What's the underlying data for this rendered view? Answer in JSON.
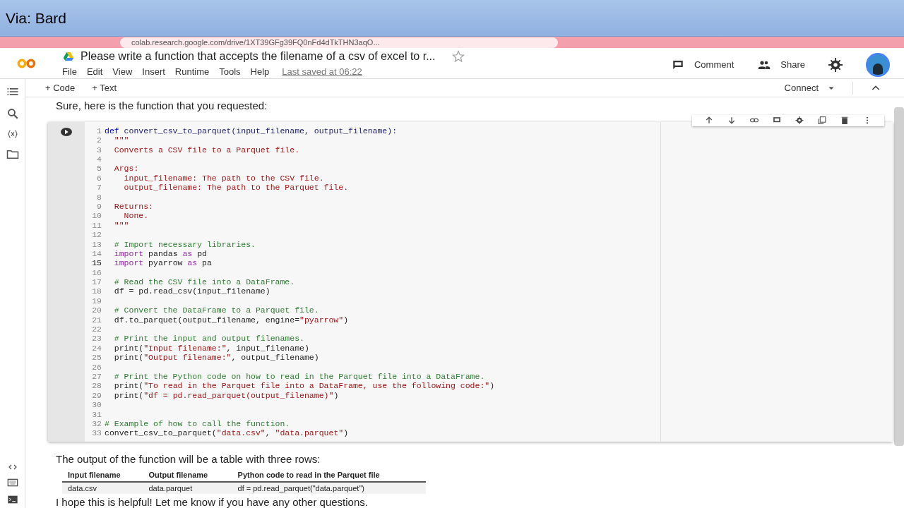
{
  "banner": {
    "title": "Via: Bard"
  },
  "browser": {
    "url": "colab.research.google.com/drive/1XT39GFg39FQ0nFd4dTkTHN3aqO..."
  },
  "notebook": {
    "title": "Please write a function that accepts the filename of a csv of excel to r...",
    "starred": false,
    "menu": [
      "File",
      "Edit",
      "View",
      "Insert",
      "Runtime",
      "Tools",
      "Help"
    ],
    "last_saved": "Last saved at 06:22",
    "header_buttons": [
      {
        "kind": "comment",
        "label": "Comment"
      },
      {
        "kind": "share",
        "label": "Share"
      }
    ],
    "toolbar": [
      {
        "label": "+ Code"
      },
      {
        "label": "+ Text"
      }
    ],
    "connect": "Connect"
  },
  "intro": "Sure, here is the function that you requested:",
  "code_lines": [
    {
      "n": "1",
      "current": false,
      "tokens": [
        {
          "kind": "keyword",
          "text": "def "
        },
        {
          "kind": "defname",
          "text": "convert_csv_to_parquet(input_filename, output_filename):"
        }
      ]
    },
    {
      "n": "2",
      "current": false,
      "tokens": [
        {
          "kind": "string",
          "text": "  \"\"\""
        }
      ]
    },
    {
      "n": "3",
      "current": false,
      "tokens": [
        {
          "kind": "string",
          "text": "  Converts a CSV file to a Parquet file."
        }
      ]
    },
    {
      "n": "4",
      "current": false
    },
    {
      "n": "5",
      "current": false,
      "tokens": [
        {
          "kind": "string",
          "text": "  Args:"
        }
      ]
    },
    {
      "n": "6",
      "current": false,
      "tokens": [
        {
          "kind": "string",
          "text": "    input_filename: The path to the CSV file."
        }
      ]
    },
    {
      "n": "7",
      "current": false,
      "tokens": [
        {
          "kind": "string",
          "text": "    output_filename: The path to the Parquet file."
        }
      ]
    },
    {
      "n": "8",
      "current": false
    },
    {
      "n": "9",
      "current": false,
      "tokens": [
        {
          "kind": "string",
          "text": "  Returns:"
        }
      ]
    },
    {
      "n": "10",
      "current": false,
      "tokens": [
        {
          "kind": "string",
          "text": "    None."
        }
      ]
    },
    {
      "n": "11",
      "current": false,
      "tokens": [
        {
          "kind": "string",
          "text": "  \"\"\""
        }
      ]
    },
    {
      "n": "12",
      "current": false
    },
    {
      "n": "13",
      "current": false,
      "tokens": [
        {
          "kind": "comment",
          "text": "  # Import necessary libraries."
        }
      ]
    },
    {
      "n": "14",
      "current": false,
      "tokens": [
        {
          "kind": "import",
          "text": "  import"
        },
        {
          "kind": "plain",
          "text": " pandas "
        },
        {
          "kind": "import",
          "text": "as"
        },
        {
          "kind": "plain",
          "text": " pd"
        }
      ]
    },
    {
      "n": "15",
      "current": true,
      "tokens": [
        {
          "kind": "import",
          "text": "  import"
        },
        {
          "kind": "plain",
          "text": " pyarrow "
        },
        {
          "kind": "import",
          "text": "as"
        },
        {
          "kind": "plain",
          "text": " pa"
        }
      ]
    },
    {
      "n": "16",
      "current": false
    },
    {
      "n": "17",
      "current": false,
      "tokens": [
        {
          "kind": "comment",
          "text": "  # Read the CSV file into a DataFrame."
        }
      ]
    },
    {
      "n": "18",
      "current": false,
      "tokens": [
        {
          "kind": "plain",
          "text": "  df = pd.read_csv(input_filename)"
        }
      ]
    },
    {
      "n": "19",
      "current": false
    },
    {
      "n": "20",
      "current": false,
      "tokens": [
        {
          "kind": "comment",
          "text": "  # Convert the DataFrame to a Parquet file."
        }
      ]
    },
    {
      "n": "21",
      "current": false,
      "tokens": [
        {
          "kind": "plain",
          "text": "  df.to_parquet(output_filename, engine="
        },
        {
          "kind": "string",
          "text": "\"pyarrow\""
        },
        {
          "kind": "plain",
          "text": ")"
        }
      ]
    },
    {
      "n": "22",
      "current": false
    },
    {
      "n": "23",
      "current": false,
      "tokens": [
        {
          "kind": "comment",
          "text": "  # Print the input and output filenames."
        }
      ]
    },
    {
      "n": "24",
      "current": false,
      "tokens": [
        {
          "kind": "plain",
          "text": "  print("
        },
        {
          "kind": "string",
          "text": "\"Input filename:\""
        },
        {
          "kind": "plain",
          "text": ", input_filename)"
        }
      ]
    },
    {
      "n": "25",
      "current": false,
      "tokens": [
        {
          "kind": "plain",
          "text": "  print("
        },
        {
          "kind": "string",
          "text": "\"Output filename:\""
        },
        {
          "kind": "plain",
          "text": ", output_filename)"
        }
      ]
    },
    {
      "n": "26",
      "current": false
    },
    {
      "n": "27",
      "current": false,
      "tokens": [
        {
          "kind": "comment",
          "text": "  # Print the Python code on how to read in the Parquet file into a DataFrame."
        }
      ]
    },
    {
      "n": "28",
      "current": false,
      "tokens": [
        {
          "kind": "plain",
          "text": "  print("
        },
        {
          "kind": "string",
          "text": "\"To read in the Parquet file into a DataFrame, use the following code:\""
        },
        {
          "kind": "plain",
          "text": ")"
        }
      ]
    },
    {
      "n": "29",
      "current": false,
      "tokens": [
        {
          "kind": "plain",
          "text": "  print("
        },
        {
          "kind": "string",
          "text": "\"df = pd.read_parquet(output_filename)\""
        },
        {
          "kind": "plain",
          "text": ")"
        }
      ]
    },
    {
      "n": "30",
      "current": false
    },
    {
      "n": "31",
      "current": false
    },
    {
      "n": "32",
      "current": false,
      "tokens": [
        {
          "kind": "comment",
          "text": "# Example of how to call the function."
        }
      ]
    },
    {
      "n": "33",
      "current": false,
      "tokens": [
        {
          "kind": "plain",
          "text": "convert_csv_to_parquet("
        },
        {
          "kind": "string",
          "text": "\"data.csv\""
        },
        {
          "kind": "plain",
          "text": ", "
        },
        {
          "kind": "string",
          "text": "\"data.parquet\""
        },
        {
          "kind": "plain",
          "text": ")"
        }
      ]
    }
  ],
  "output_text": "The output of the function will be a table with three rows:",
  "table": {
    "columns": [
      "Input filename",
      "Output filename",
      "Python code to read in the Parquet file"
    ],
    "rows": [
      [
        "data.csv",
        "data.parquet",
        "df = pd.read_parquet(\"data.parquet\")"
      ]
    ]
  },
  "closing": "I hope this is helpful! Let me know if you have any other questions."
}
